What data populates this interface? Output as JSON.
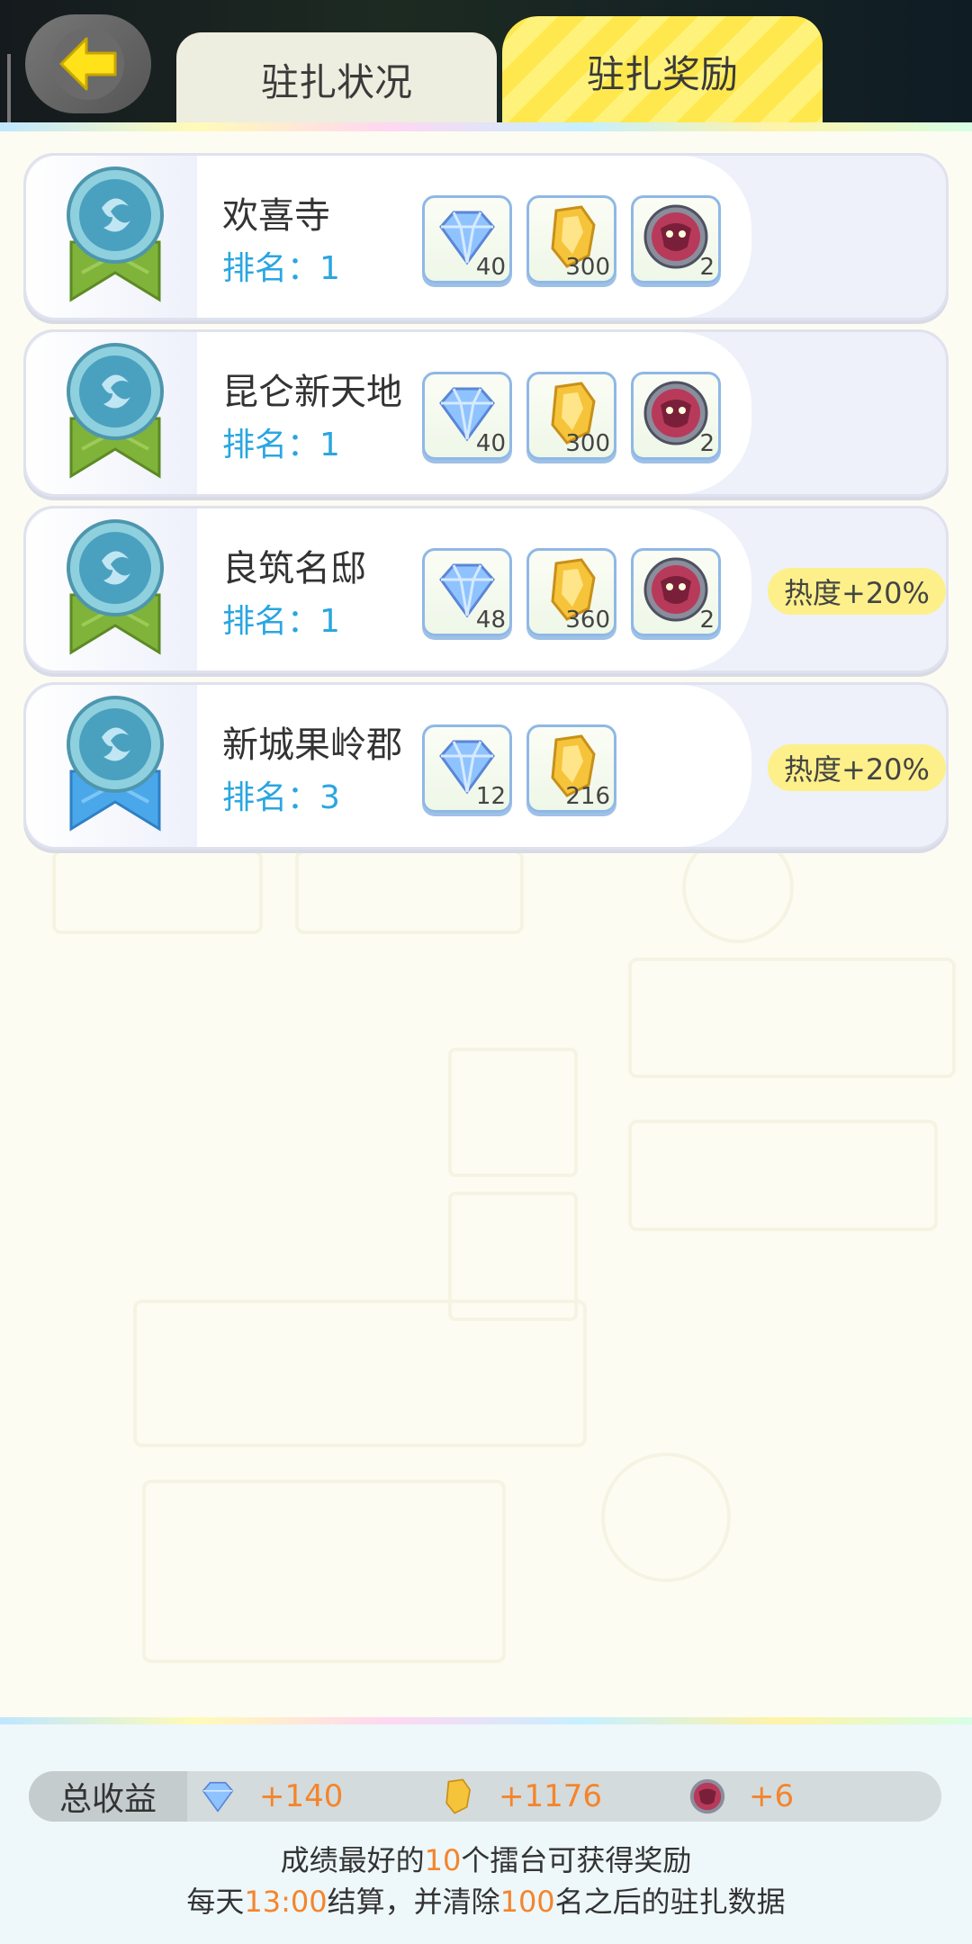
{
  "header": {
    "back_icon": "back-arrow-icon",
    "tabs": [
      {
        "label": "驻扎状况",
        "active": false
      },
      {
        "label": "驻扎奖励",
        "active": true
      }
    ]
  },
  "rewards": [
    {
      "name": "欢喜寺",
      "rank_label": "排名：1",
      "medal": "green",
      "items": [
        {
          "icon": "diamond-icon",
          "count": "40"
        },
        {
          "icon": "gold-crystal-icon",
          "count": "300"
        },
        {
          "icon": "demon-token-icon",
          "count": "2"
        }
      ],
      "bonus": ""
    },
    {
      "name": "昆仑新天地",
      "rank_label": "排名：1",
      "medal": "green",
      "items": [
        {
          "icon": "diamond-icon",
          "count": "40"
        },
        {
          "icon": "gold-crystal-icon",
          "count": "300"
        },
        {
          "icon": "demon-token-icon",
          "count": "2"
        }
      ],
      "bonus": ""
    },
    {
      "name": "良筑名邸",
      "rank_label": "排名：1",
      "medal": "green",
      "items": [
        {
          "icon": "diamond-icon",
          "count": "48"
        },
        {
          "icon": "gold-crystal-icon",
          "count": "360"
        },
        {
          "icon": "demon-token-icon",
          "count": "2"
        }
      ],
      "bonus": "热度+20%"
    },
    {
      "name": "新城果岭郡",
      "rank_label": "排名：3",
      "medal": "blue",
      "items": [
        {
          "icon": "diamond-icon",
          "count": "12"
        },
        {
          "icon": "gold-crystal-icon",
          "count": "216"
        }
      ],
      "bonus": "热度+20%"
    }
  ],
  "footer": {
    "total_label": "总收益",
    "totals": [
      {
        "icon": "diamond-icon",
        "value": "+140"
      },
      {
        "icon": "gold-crystal-icon",
        "value": "+1176"
      },
      {
        "icon": "demon-token-icon",
        "value": "+6"
      }
    ],
    "note1": {
      "a": "成绩最好的",
      "b": "10",
      "c": "个擂台可获得奖励"
    },
    "note2": {
      "a": "每天",
      "b": "13:00",
      "c": "结算，并清除",
      "d": "100",
      "e": "名之后的驻扎数据"
    }
  },
  "colors": {
    "accent": "#2aa6e0",
    "highlight": "#f4852c",
    "tab_active": "#ffe84d",
    "bonus_bg": "#fdf08a"
  }
}
